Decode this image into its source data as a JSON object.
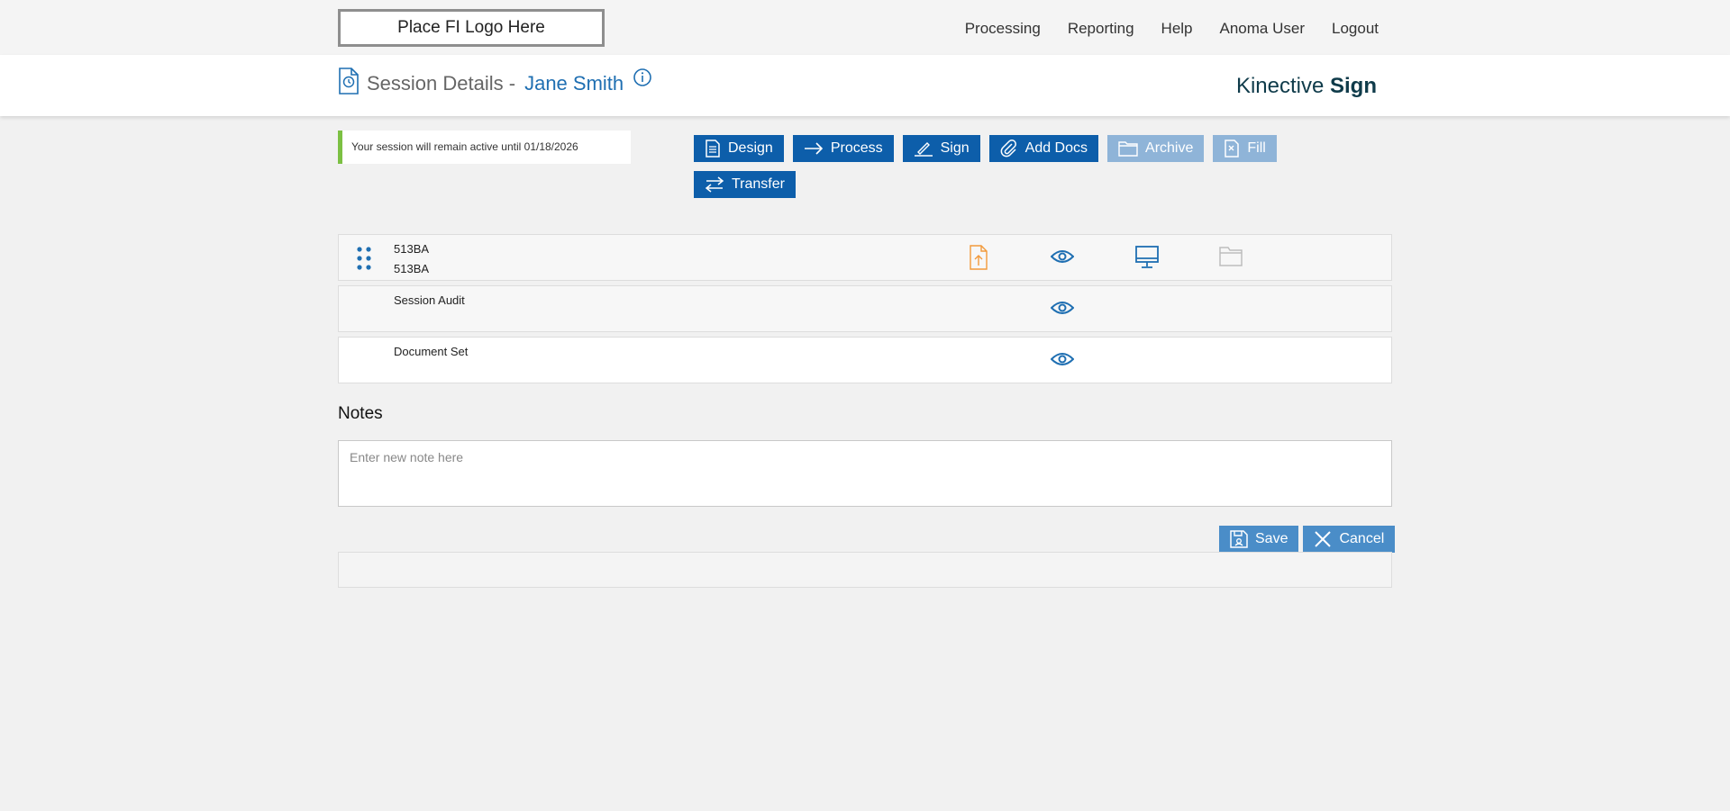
{
  "topbar": {
    "logo_text": "Place FI Logo Here",
    "nav": [
      "Processing",
      "Reporting",
      "Help",
      "Anoma User",
      "Logout"
    ]
  },
  "header": {
    "title": "Session Details -",
    "name": "Jane Smith",
    "brand_light": "Kinective",
    "brand_bold": "Sign",
    "icons": [
      "session-history-icon",
      "info-icon"
    ]
  },
  "session_note": "Your session will remain active until 01/18/2026",
  "actions": [
    {
      "label": "Design",
      "icon": "document-icon",
      "enabled": true
    },
    {
      "label": "Process",
      "icon": "arrow-right-icon",
      "enabled": true
    },
    {
      "label": "Sign",
      "icon": "pen-icon",
      "enabled": true
    },
    {
      "label": "Add Docs",
      "icon": "paperclip-icon",
      "enabled": true
    },
    {
      "label": "Archive",
      "icon": "folder-icon",
      "enabled": false
    },
    {
      "label": "Fill",
      "icon": "fill-doc-icon",
      "enabled": false
    },
    {
      "label": "Transfer",
      "icon": "transfer-icon",
      "enabled": true
    }
  ],
  "documents": [
    {
      "line1": "513BA",
      "line2": "513BA",
      "icons": [
        "drag-handle-icon",
        "upload-file-icon",
        "eye-icon",
        "monitor-icon",
        "folder-icon"
      ]
    },
    {
      "line1": "Session Audit",
      "line2": "",
      "icons": [
        "eye-icon"
      ]
    },
    {
      "line1": "Document Set",
      "line2": "",
      "icons": [
        "eye-icon"
      ]
    }
  ],
  "notes": {
    "title": "Notes",
    "placeholder": "Enter new note here",
    "value": "",
    "save_label": "Save",
    "cancel_label": "Cancel"
  },
  "colors": {
    "primary": "#0d5eaa",
    "disabled": "#8fb4d8",
    "accent_green": "#7cc043",
    "upload_orange": "#f29a3b",
    "brand_text": "#0f3b4a"
  }
}
